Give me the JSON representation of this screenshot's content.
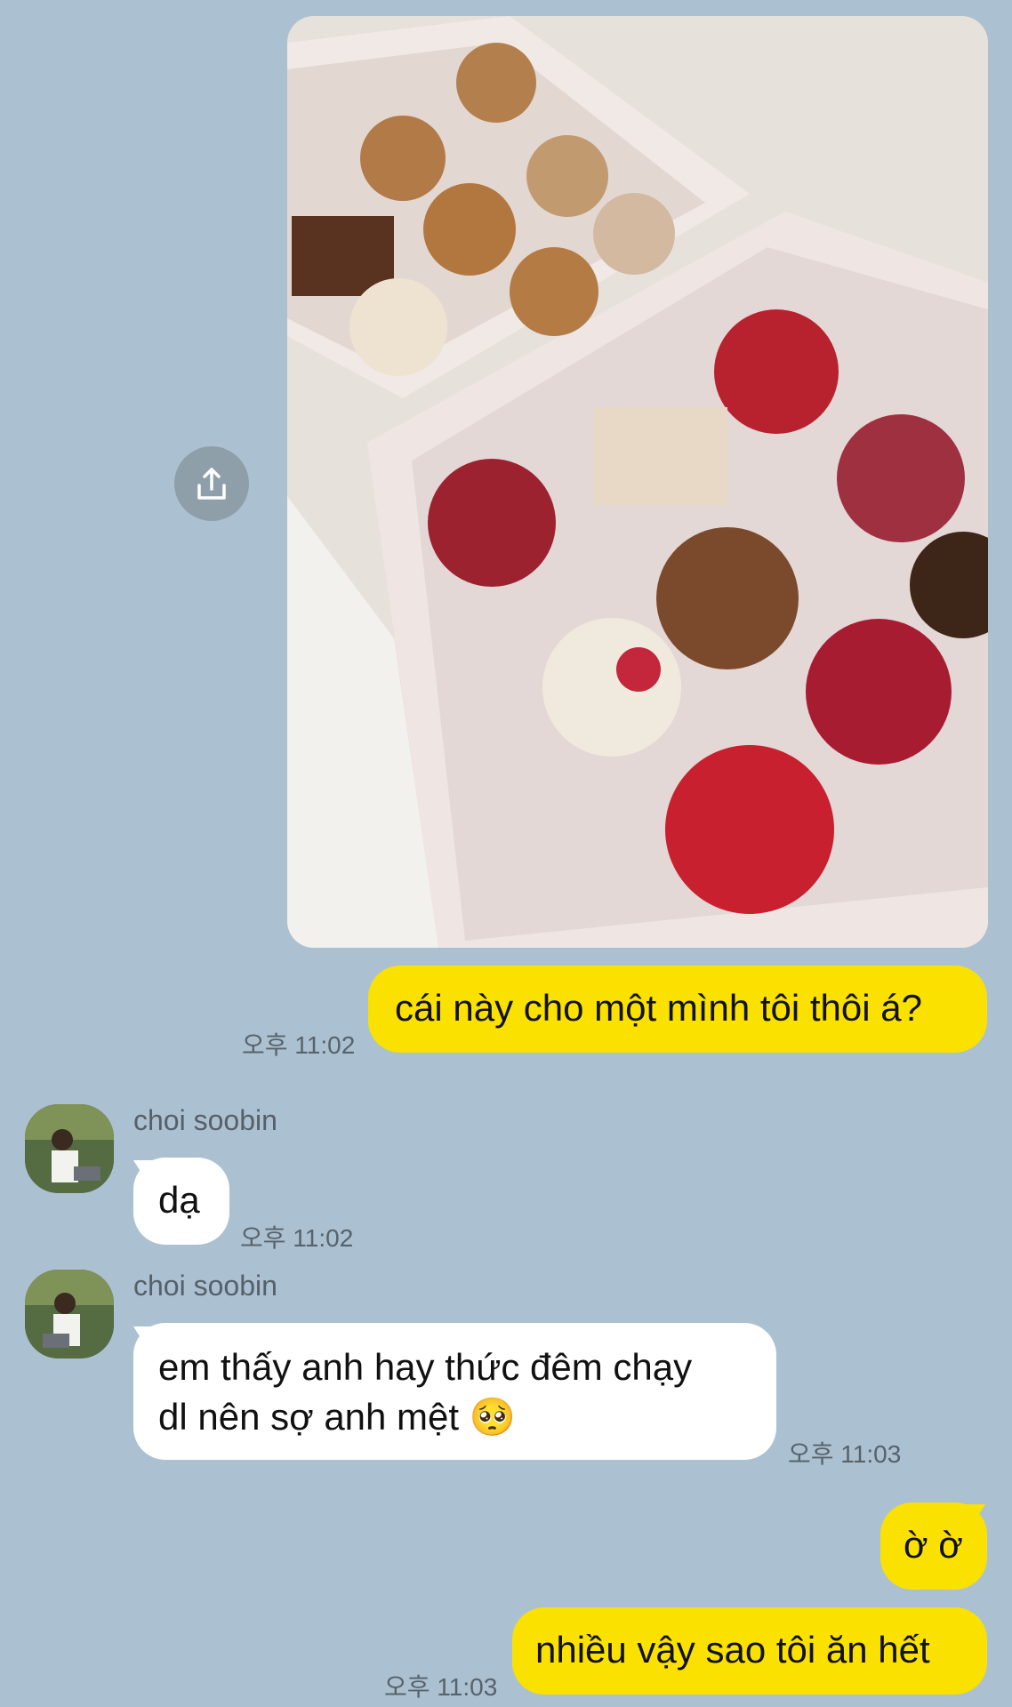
{
  "shared_image": {
    "icon": "share-icon"
  },
  "messages": [
    {
      "sender": "me",
      "text": "cái này cho một mình tôi thôi á?",
      "time": "오후 11:02"
    },
    {
      "sender": "choi soobin",
      "text": "dạ",
      "time": "오후 11:02"
    },
    {
      "sender": "choi soobin",
      "line1": "em thấy anh hay thức đêm chạy",
      "line2": "dl nên sợ anh mệt",
      "emoji": "🥺",
      "time": "오후 11:03"
    },
    {
      "sender": "me",
      "text": "ờ ờ"
    },
    {
      "sender": "me",
      "text": "nhiều vậy sao tôi ăn hết",
      "time": "오후 11:03"
    }
  ],
  "colors": {
    "background": "#abc1d1",
    "my_bubble": "#fae100",
    "their_bubble": "#ffffff"
  }
}
